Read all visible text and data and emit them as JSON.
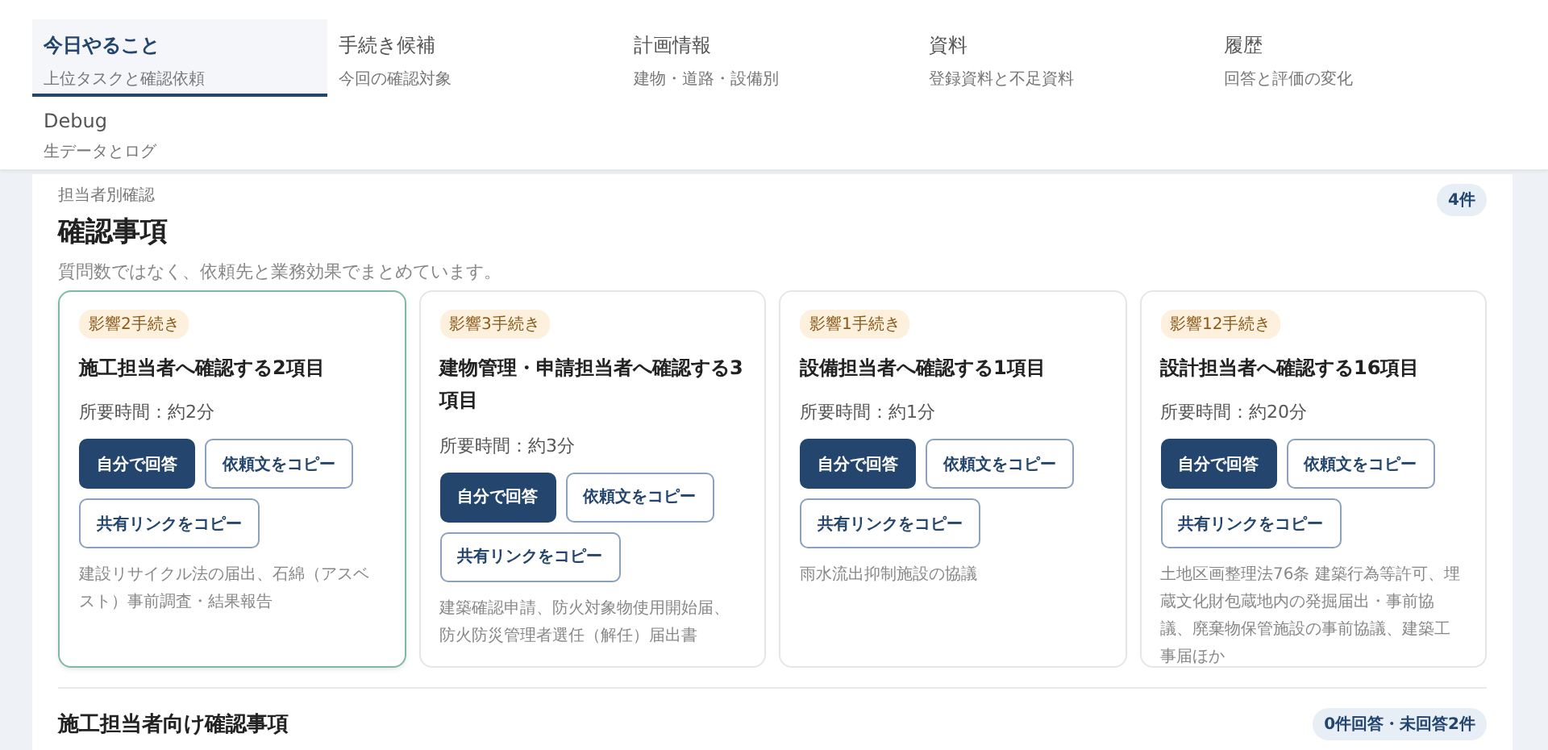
{
  "tabs": [
    {
      "label": "今日やること",
      "subtitle": "上位タスクと確認依頼",
      "selected": true
    },
    {
      "label": "手続き候補",
      "subtitle": "今回の確認対象",
      "selected": false
    },
    {
      "label": "計画情報",
      "subtitle": "建物・道路・設備別",
      "selected": false
    },
    {
      "label": "資料",
      "subtitle": "登録資料と不足資料",
      "selected": false
    },
    {
      "label": "履歴",
      "subtitle": "回答と評価の変化",
      "selected": false
    },
    {
      "label": "Debug",
      "subtitle": "生データとログ",
      "selected": false
    }
  ],
  "section": {
    "eyebrow": "担当者別確認",
    "title": "確認事項",
    "count": "4件",
    "description": "質問数ではなく、依頼先と業務効果でまとめています。"
  },
  "cards": [
    {
      "badge": "影響2手続き",
      "title": "施工担当者へ確認する2項目",
      "time": "所要時間：約2分",
      "actions": [
        "自分で回答",
        "依頼文をコピー",
        "共有リンクをコピー"
      ],
      "procedures": "建設リサイクル法の届出、石綿（アスベスト）事前調査・結果報告",
      "selected": true
    },
    {
      "badge": "影響3手続き",
      "title": "建物管理・申請担当者へ確認する3項目",
      "time": "所要時間：約3分",
      "actions": [
        "自分で回答",
        "依頼文をコピー",
        "共有リンクをコピー"
      ],
      "procedures": "建築確認申請、防火対象物使用開始届、防火防災管理者選任（解任）届出書",
      "selected": false
    },
    {
      "badge": "影響1手続き",
      "title": "設備担当者へ確認する1項目",
      "time": "所要時間：約1分",
      "actions": [
        "自分で回答",
        "依頼文をコピー",
        "共有リンクをコピー"
      ],
      "procedures": "雨水流出抑制施設の協議",
      "selected": false
    },
    {
      "badge": "影響12手続き",
      "title": "設計担当者へ確認する16項目",
      "time": "所要時間：約20分",
      "actions": [
        "自分で回答",
        "依頼文をコピー",
        "共有リンクをコピー"
      ],
      "procedures": "土地区画整理法76条 建築行為等許可、埋蔵文化財包蔵地内の発掘届出・事前協議、廃棄物保管施設の事前協議、建築工事届ほか",
      "selected": false
    }
  ],
  "next_section": {
    "title": "施工担当者向け確認事項",
    "status": "0件回答・未回答2件"
  }
}
